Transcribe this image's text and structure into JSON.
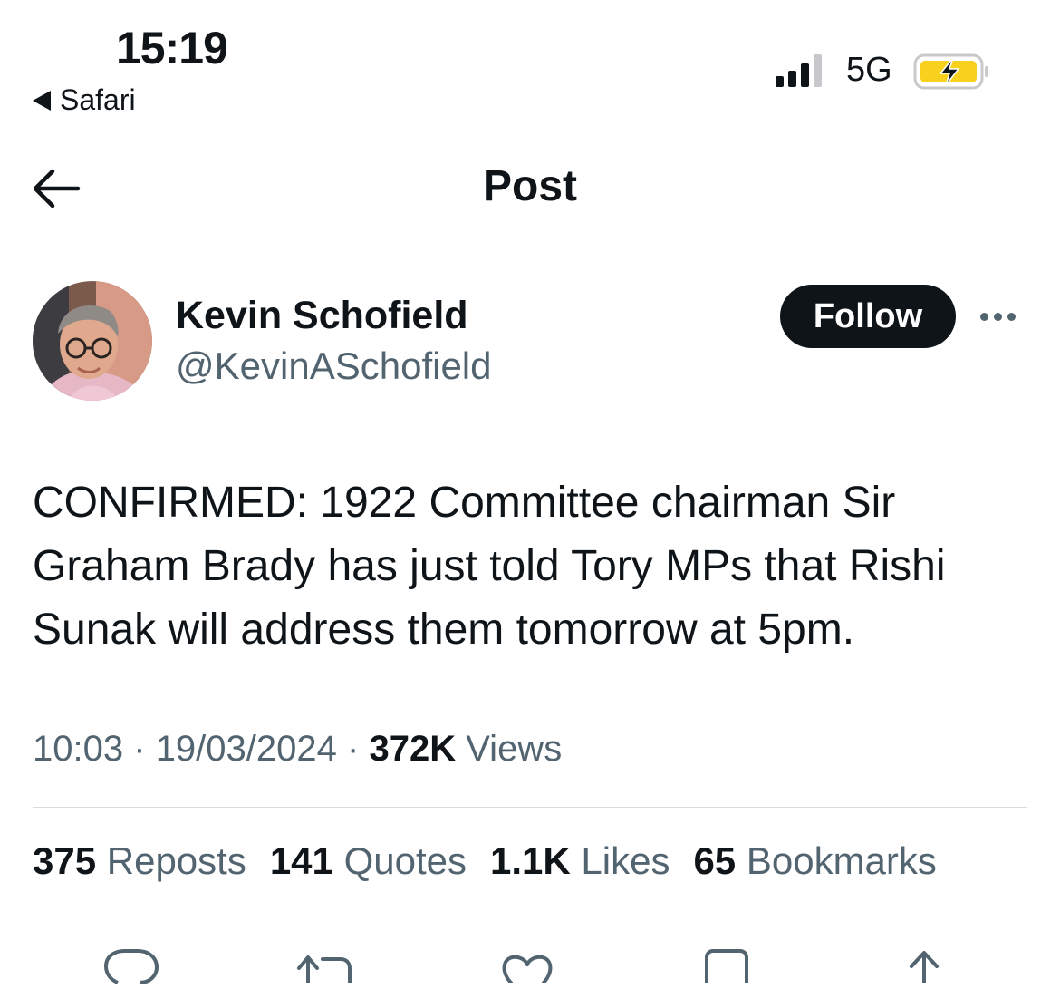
{
  "status_bar": {
    "time": "15:19",
    "back_app": "Safari",
    "network": "5G",
    "battery_color": "#f7d11e"
  },
  "header": {
    "title": "Post"
  },
  "author": {
    "name": "Kevin Schofield",
    "handle": "@KevinASchofield",
    "follow_label": "Follow"
  },
  "tweet": {
    "text": "CONFIRMED: 1922 Committee chairman Sir Graham Brady has just told Tory MPs that Rishi Sunak will address them tomorrow at 5pm."
  },
  "meta": {
    "time": "10:03",
    "date": "19/03/2024",
    "views_count": "372K",
    "views_label": "Views",
    "separator": "·"
  },
  "stats": [
    {
      "count": "375",
      "label": "Reposts"
    },
    {
      "count": "141",
      "label": "Quotes"
    },
    {
      "count": "1.1K",
      "label": "Likes"
    },
    {
      "count": "65",
      "label": "Bookmarks"
    }
  ],
  "icons": {
    "back": "arrow-left-icon",
    "more": "more-icon",
    "reply": "reply-icon",
    "repost": "repost-icon",
    "like": "heart-icon",
    "bookmark": "bookmark-icon",
    "share": "share-icon"
  }
}
